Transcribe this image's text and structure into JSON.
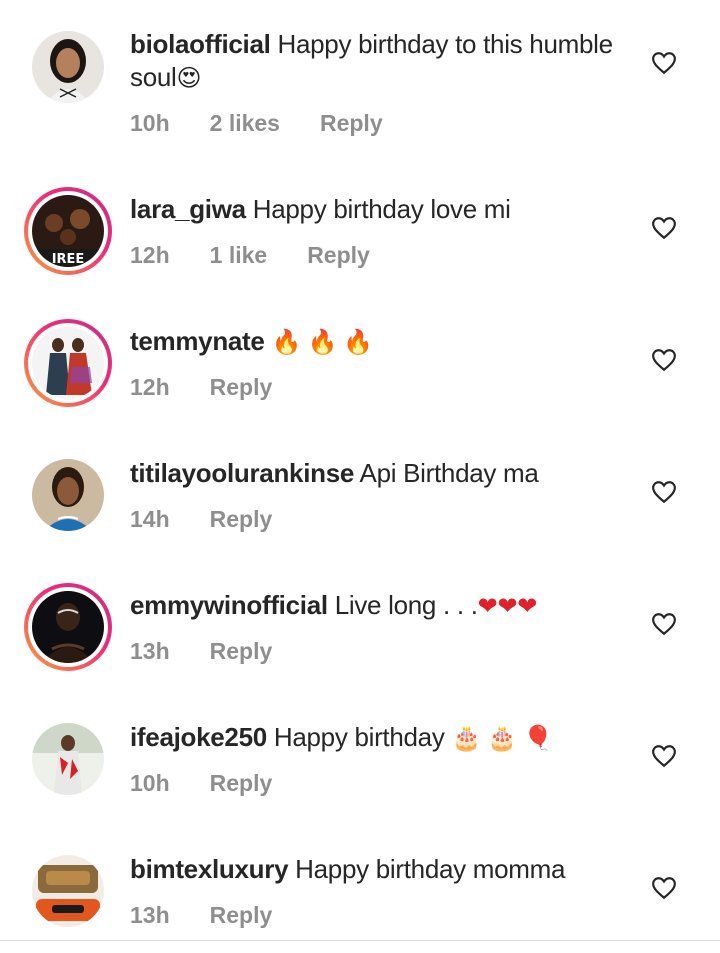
{
  "comments": [
    {
      "username": "biolaofficial",
      "text": "Happy birthday to this humble",
      "text2": "soul",
      "emoji": "😍",
      "time": "10h",
      "likes": "2 likes",
      "reply": "Reply"
    },
    {
      "username": "lara_giwa",
      "text": "Happy birthday love mi",
      "emoji": "",
      "time": "12h",
      "likes": "1 like",
      "reply": "Reply"
    },
    {
      "username": "temmynate",
      "text": "",
      "emoji": "🔥 🔥 🔥",
      "time": "12h",
      "likes": "",
      "reply": "Reply"
    },
    {
      "username": "titilayoolurankinse",
      "text": "Api Birthday ma",
      "emoji": "",
      "time": "14h",
      "likes": "",
      "reply": "Reply"
    },
    {
      "username": "emmywinofficial",
      "text": "Live long . . .",
      "emoji": "❤❤❤",
      "time": "13h",
      "likes": "",
      "reply": "Reply"
    },
    {
      "username": "ifeajoke250",
      "text": "Happy birthday",
      "emoji": "🎂 🎂 🎈",
      "time": "10h",
      "likes": "",
      "reply": "Reply"
    },
    {
      "username": "bimtexluxury",
      "text": "Happy birthday momma",
      "emoji": "",
      "time": "13h",
      "likes": "",
      "reply": "Reply"
    }
  ],
  "icons": {
    "like": "heart-outline-icon",
    "avatar": "profile-photo"
  },
  "colors": {
    "text": "#262626",
    "meta": "#8e8e8e",
    "story_ring": "#ee2a7b"
  }
}
